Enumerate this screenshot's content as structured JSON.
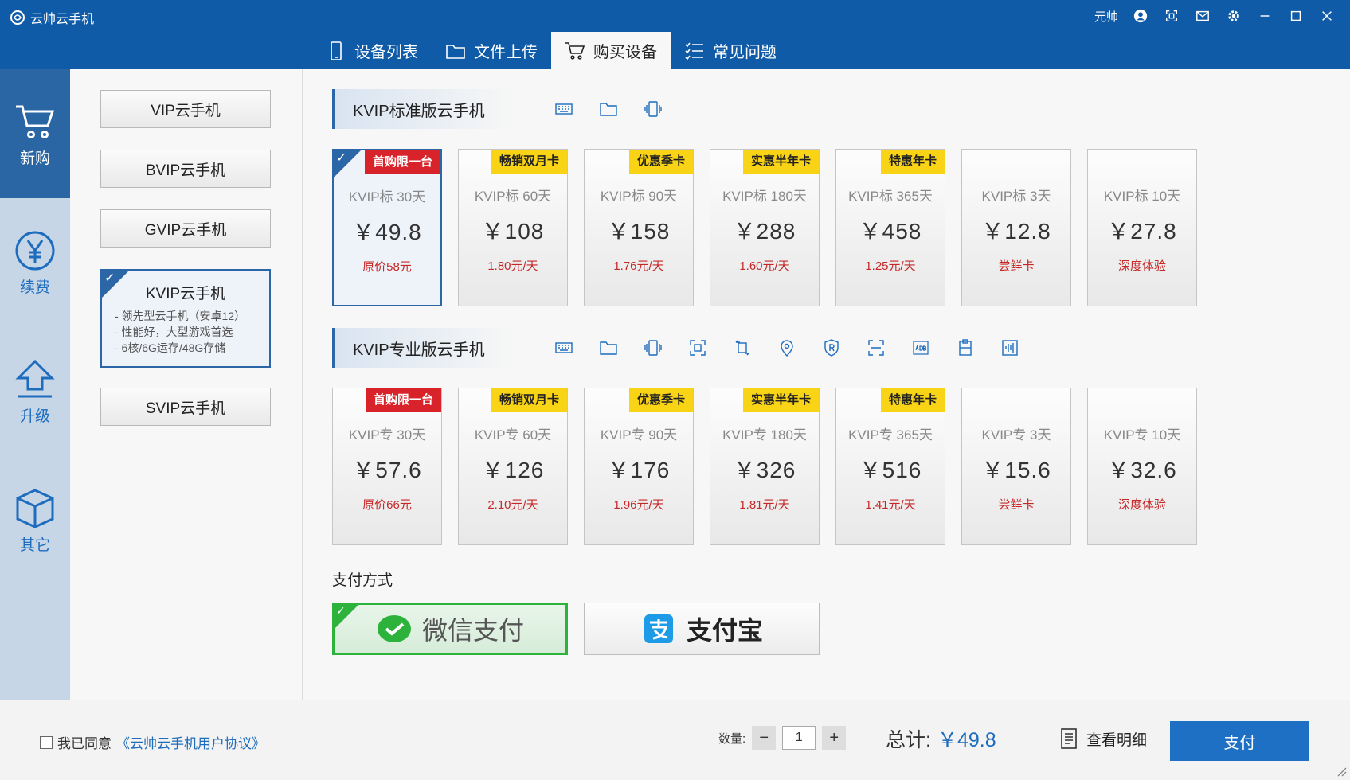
{
  "app": {
    "title": "云帅云手机",
    "user": "元帅"
  },
  "tabs": [
    {
      "label": "设备列表",
      "icon": "phone-icon"
    },
    {
      "label": "文件上传",
      "icon": "folder-icon"
    },
    {
      "label": "购买设备",
      "icon": "cart-icon",
      "active": true
    },
    {
      "label": "常见问题",
      "icon": "checklist-icon"
    }
  ],
  "leftnav": [
    {
      "label": "新购",
      "icon": "cart-icon",
      "active": true
    },
    {
      "label": "续费",
      "icon": "yen-icon"
    },
    {
      "label": "升级",
      "icon": "upload-arrow-icon"
    },
    {
      "label": "其它",
      "icon": "box-icon"
    }
  ],
  "series": {
    "vip": "VIP云手机",
    "bvip": "BVIP云手机",
    "gvip": "GVIP云手机",
    "kvip": {
      "name": "KVIP云手机",
      "desc": [
        "- 领先型云手机（安卓12）",
        "- 性能好，大型游戏首选",
        "- 6核/6G运存/48G存储"
      ]
    },
    "svip": "SVIP云手机"
  },
  "standard": {
    "title": "KVIP标准版云手机",
    "cards": [
      {
        "badge": "首购限一台",
        "name": "KVIP标 30天",
        "price": "￥49.8",
        "note": "原价58元"
      },
      {
        "badge": "畅销双月卡",
        "name": "KVIP标 60天",
        "price": "￥108",
        "note": "1.80元/天"
      },
      {
        "badge": "优惠季卡",
        "name": "KVIP标 90天",
        "price": "￥158",
        "note": "1.76元/天"
      },
      {
        "badge": "实惠半年卡",
        "name": "KVIP标 180天",
        "price": "￥288",
        "note": "1.60元/天"
      },
      {
        "badge": "特惠年卡",
        "name": "KVIP标 365天",
        "price": "￥458",
        "note": "1.25元/天"
      },
      {
        "badge": "",
        "name": "KVIP标 3天",
        "price": "￥12.8",
        "note": "尝鲜卡"
      },
      {
        "badge": "",
        "name": "KVIP标 10天",
        "price": "￥27.8",
        "note": "深度体验"
      }
    ]
  },
  "pro": {
    "title": "KVIP专业版云手机",
    "cards": [
      {
        "badge": "首购限一台",
        "name": "KVIP专 30天",
        "price": "￥57.6",
        "note": "原价66元"
      },
      {
        "badge": "畅销双月卡",
        "name": "KVIP专 60天",
        "price": "￥126",
        "note": "2.10元/天"
      },
      {
        "badge": "优惠季卡",
        "name": "KVIP专 90天",
        "price": "￥176",
        "note": "1.96元/天"
      },
      {
        "badge": "实惠半年卡",
        "name": "KVIP专 180天",
        "price": "￥326",
        "note": "1.81元/天"
      },
      {
        "badge": "特惠年卡",
        "name": "KVIP专 365天",
        "price": "￥516",
        "note": "1.41元/天"
      },
      {
        "badge": "",
        "name": "KVIP专 3天",
        "price": "￥15.6",
        "note": "尝鲜卡"
      },
      {
        "badge": "",
        "name": "KVIP专 10天",
        "price": "￥32.6",
        "note": "深度体验"
      }
    ]
  },
  "payment": {
    "label": "支付方式",
    "wechat": "微信支付",
    "alipay": "支付宝"
  },
  "footer": {
    "agree_prefix": "我已同意",
    "agree_link": "《云帅云手机用户协议》",
    "qty_label": "数量:",
    "qty_minus": "−",
    "qty_value": "1",
    "qty_plus": "+",
    "total_label": "总计:",
    "total_amount": "￥49.8",
    "detail_label": "查看明细",
    "pay_label": "支付"
  },
  "colors": {
    "brand": "#0f5ba7",
    "accent": "#1e70c4",
    "badge_red": "#d8232a",
    "badge_yellow": "#f8d316",
    "wechat_green": "#2db33c"
  }
}
